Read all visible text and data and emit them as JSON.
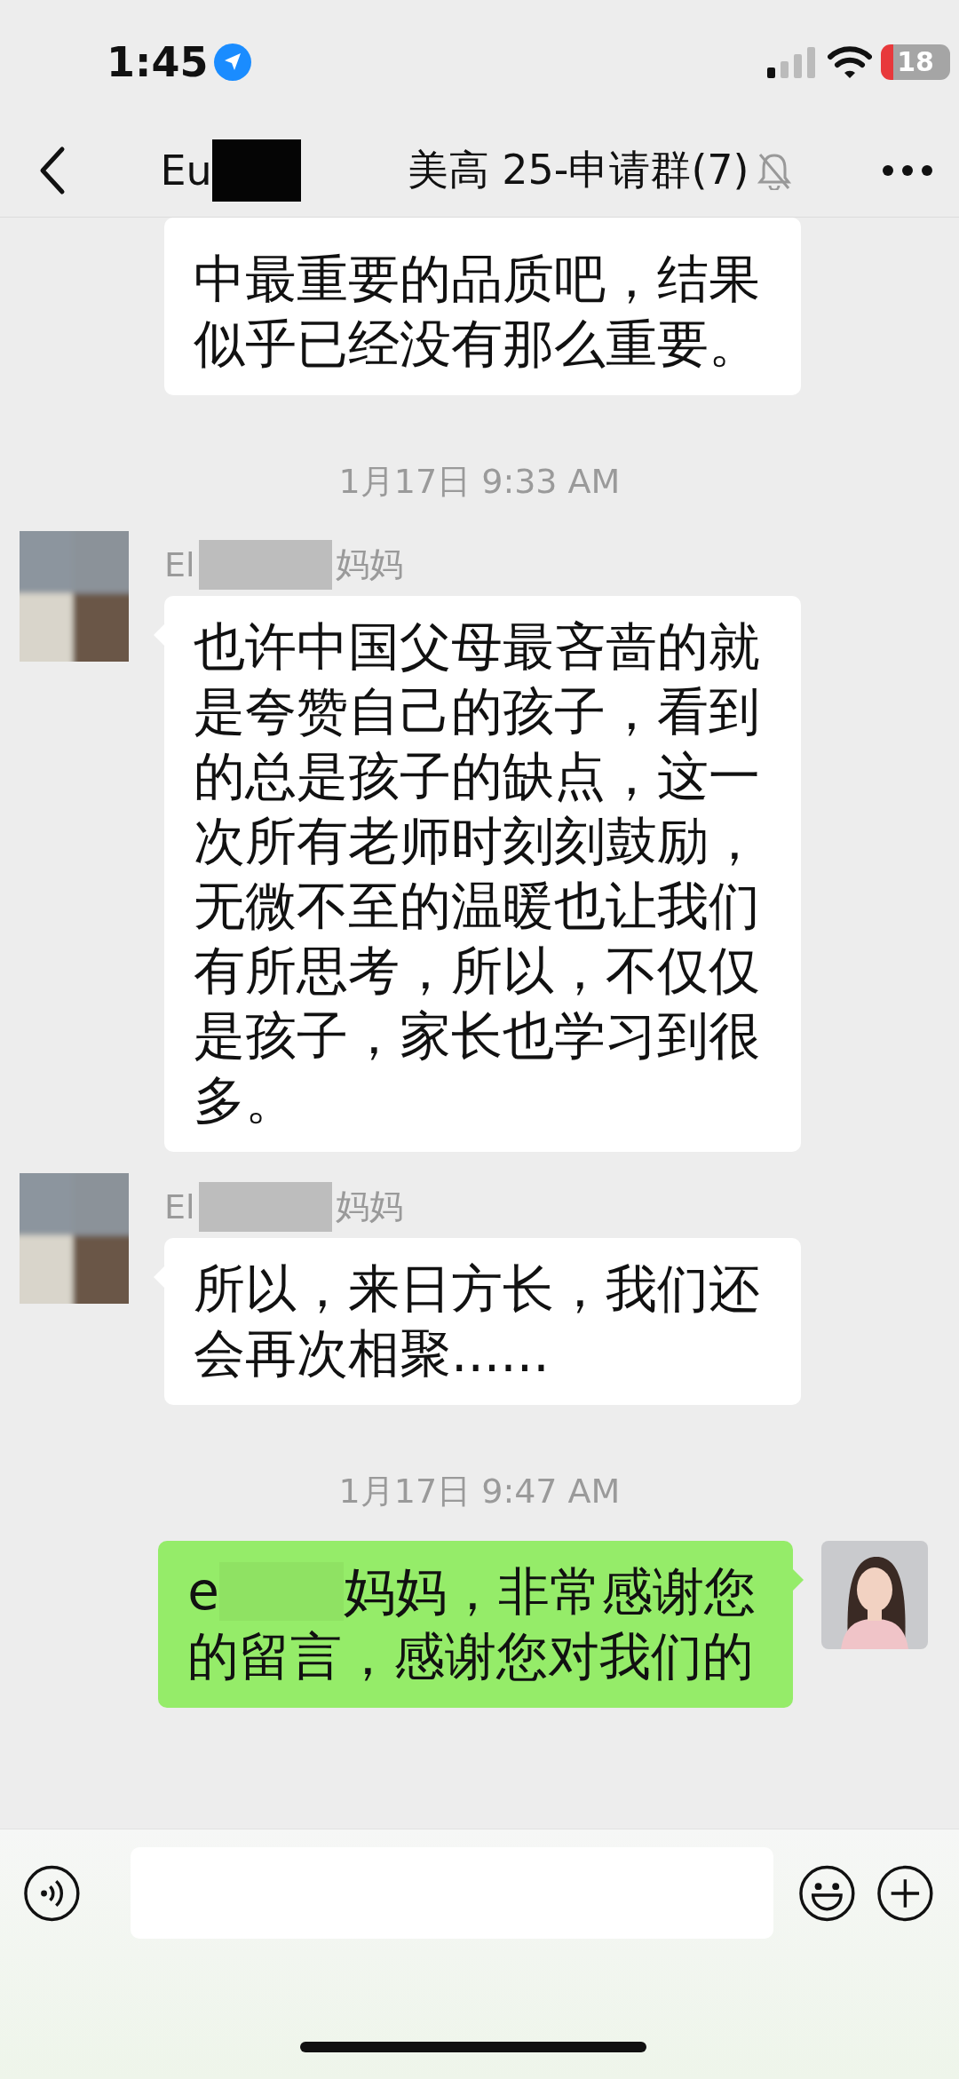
{
  "status_bar": {
    "time": "1:45",
    "battery": "18"
  },
  "header": {
    "title_start": "Eu",
    "title": "美高 25-申请群(7)",
    "muted": true
  },
  "messages": [
    {
      "kind": "incoming",
      "text": "中最重要的品质吧，结果似乎已经没有那么重要。"
    },
    {
      "kind": "time",
      "text": "1月17日 9:33 AM"
    },
    {
      "kind": "incoming",
      "sender_start": "El",
      "sender_end": "妈妈",
      "text": "也许中国父母最吝啬的就是夸赞自己的孩子，看到的总是孩子的缺点，这一次所有老师时刻刻鼓励，无微不至的温暖也让我们有所思考，所以，不仅仅是孩子，家长也学习到很多。"
    },
    {
      "kind": "incoming",
      "sender_start": "El",
      "sender_end": "妈妈",
      "text": "所以，来日方长，我们还会再次相聚......"
    },
    {
      "kind": "time",
      "text": "1月17日 9:47 AM"
    },
    {
      "kind": "outgoing",
      "text_start": "e",
      "lines": [
        "妈妈，非常感谢您",
        "的留言，感谢您对我们的"
      ]
    }
  ]
}
